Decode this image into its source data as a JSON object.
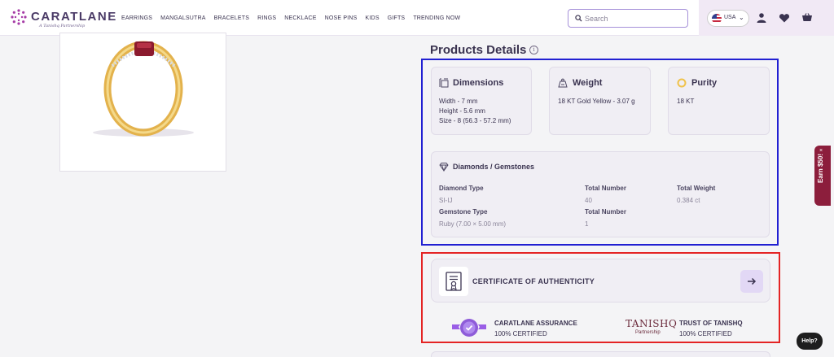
{
  "header": {
    "logo_text": "CARATLANE",
    "logo_sub": "A Tanishq Partnership",
    "nav": [
      "EARRINGS",
      "MANGALSUTRA",
      "BRACELETS",
      "RINGS",
      "NECKLACE",
      "NOSE PINS",
      "KIDS",
      "GIFTS",
      "TRENDING NOW"
    ],
    "search_placeholder": "Search",
    "country": "USA",
    "icons": [
      "user-icon",
      "heart-icon",
      "cart-icon"
    ]
  },
  "product": {
    "image": "gold-ring-with-ruby-icon"
  },
  "details": {
    "title": "Products Details",
    "dimensions": {
      "heading": "Dimensions",
      "lines": [
        "Width - 7 mm",
        "Height - 5.6 mm",
        "Size - 8 (56.3 - 57.2 mm)"
      ]
    },
    "weight": {
      "heading": "Weight",
      "value": "18 KT Gold Yellow - 3.07 g"
    },
    "purity": {
      "heading": "Purity",
      "value": "18 KT"
    },
    "gems": {
      "heading": "Diamonds / Gemstones",
      "diamond_type_label": "Diamond Type",
      "diamond_type_value": "SI-IJ",
      "total_number_label": "Total Number",
      "total_number_value": "40",
      "total_weight_label": "Total Weight",
      "total_weight_value": "0.384 ct",
      "gemstone_type_label": "Gemstone Type",
      "gemstone_type_value": "Ruby (7.00 × 5.00 mm)",
      "gem_total_number_label": "Total Number",
      "gem_total_number_value": "1"
    }
  },
  "certificate": {
    "label": "CERTIFICATE OF AUTHENTICITY",
    "assurance_title": "CARATLANE ASSURANCE",
    "assurance_sub": "100% CERTIFIED",
    "tanishq_logo": "TANISHQ",
    "tanishq_logo_sub": "Partnership",
    "tanishq_title": "TRUST OF TANISHQ",
    "tanishq_sub": "100% CERTIFIED"
  },
  "floating": {
    "earn": "Earn $50!",
    "help": "Help?"
  },
  "colors": {
    "accent": "#8e5cd9",
    "blue_outline": "#2120d2",
    "red_outline": "#e42424"
  }
}
